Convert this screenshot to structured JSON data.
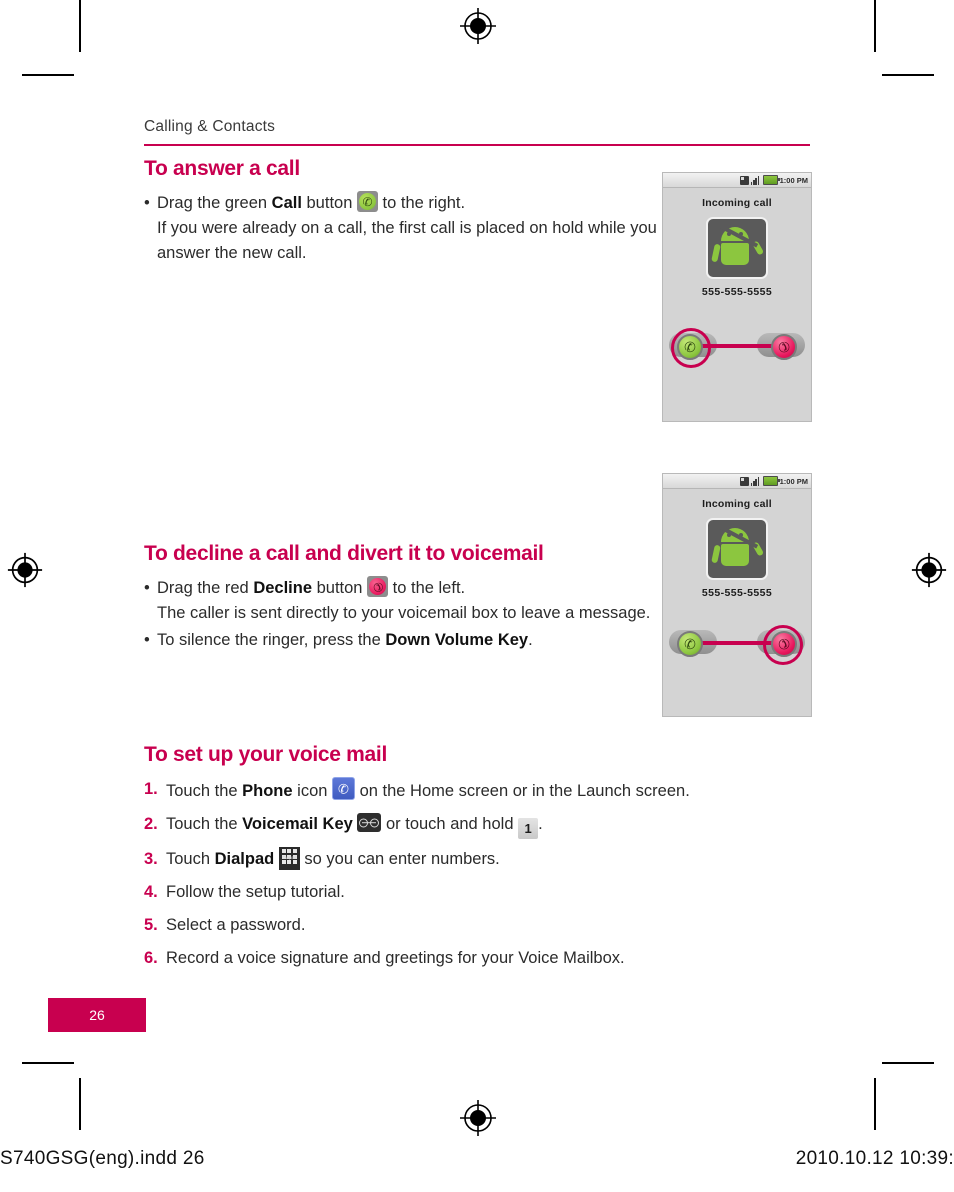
{
  "running_head": "Calling & Contacts",
  "accent_color": "#c8004f",
  "sections": [
    {
      "title": "To answer a call",
      "bullets": [
        {
          "pre": "Drag the green ",
          "bold": "Call",
          "mid": " button ",
          "icon": "call-button-icon",
          "post": " to the right.",
          "continuation": "If you were already on a call, the first call is placed on hold while you answer the new call."
        }
      ]
    },
    {
      "title": "To decline a call and divert it to voicemail",
      "bullets": [
        {
          "pre": "Drag the red ",
          "bold": "Decline",
          "mid": " button ",
          "icon": "decline-button-icon",
          "post": " to the left.",
          "continuation": "The caller is sent directly to your voicemail box to leave a message."
        },
        {
          "pre": "To silence the ringer, press the ",
          "bold": "Down Volume Key",
          "mid": "",
          "icon": null,
          "post": ".",
          "continuation": ""
        }
      ]
    }
  ],
  "voicemail_section": {
    "title": "To set up your voice mail",
    "steps": [
      {
        "number": "1.",
        "pre": "Touch the ",
        "bold": "Phone",
        "mid": " icon ",
        "icon": "phone-app-icon",
        "post": " on the Home screen or in the Launch screen."
      },
      {
        "number": "2.",
        "pre": "Touch the ",
        "bold": "Voicemail Key",
        "mid": " ",
        "icon": "voicemail-key-icon",
        "post": " or touch and hold ",
        "icon2": "one-key-icon",
        "post2": "."
      },
      {
        "number": "3.",
        "pre": "Touch ",
        "bold": "Dialpad",
        "mid": " ",
        "icon": "dialpad-icon",
        "post": " so you can enter numbers."
      },
      {
        "number": "4.",
        "pre": "Follow the setup tutorial.",
        "bold": "",
        "mid": "",
        "icon": null,
        "post": ""
      },
      {
        "number": "5.",
        "pre": "Select a password.",
        "bold": "",
        "mid": "",
        "icon": null,
        "post": ""
      },
      {
        "number": "6.",
        "pre": "Record a voice signature and greetings for your Voice Mailbox.",
        "bold": "",
        "mid": "",
        "icon": null,
        "post": ""
      }
    ]
  },
  "phone_screenshots": [
    {
      "name": "answer-call-screenshot",
      "status_time": "1:00 PM",
      "title": "Incoming call",
      "number": "555-555-5555",
      "arrow_direction": "right",
      "highlighted_button": "call"
    },
    {
      "name": "decline-call-screenshot",
      "status_time": "1:00 PM",
      "title": "Incoming call",
      "number": "555-555-5555",
      "arrow_direction": "left",
      "highlighted_button": "decline"
    }
  ],
  "page_number": "26",
  "printer_footer": {
    "file": "S740GSG(eng).indd   26",
    "date": "2010.10.12   10:39:"
  },
  "dialpad_label": "Dialpad",
  "one_key_label": "1"
}
